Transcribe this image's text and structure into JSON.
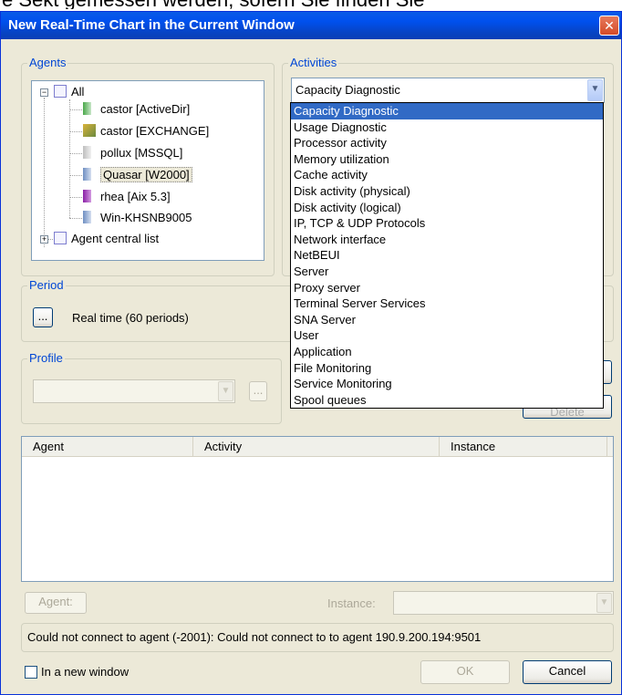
{
  "background_text": "e Sekt gemessen werden, sofern Sie finden Sie",
  "window": {
    "title": "New Real-Time Chart in the Current Window"
  },
  "agents": {
    "label": "Agents",
    "root": "All",
    "items": [
      {
        "label": "castor [ActiveDir]",
        "icon": "server-green-icon"
      },
      {
        "label": "castor [EXCHANGE]",
        "icon": "exchange-server-icon"
      },
      {
        "label": "pollux [MSSQL]",
        "icon": "sql-server-icon"
      },
      {
        "label": "Quasar [W2000]",
        "icon": "windows-server-icon"
      },
      {
        "label": "rhea [Aix 5.3]",
        "icon": "aix-server-icon"
      },
      {
        "label": "Win-KHSNB9005",
        "icon": "windows-server-icon"
      }
    ],
    "central": "Agent central list"
  },
  "activities": {
    "label": "Activities",
    "selected": "Capacity Diagnostic",
    "options": [
      "Capacity Diagnostic",
      "Usage Diagnostic",
      "Processor activity",
      "Memory utilization",
      "Cache activity",
      "Disk activity (physical)",
      "Disk activity (logical)",
      "IP, TCP & UDP Protocols",
      "Network interface",
      "NetBEUI",
      "Server",
      "Proxy server",
      "Terminal Server Services",
      "SNA Server",
      "User",
      "Application",
      "File Monitoring",
      "Service Monitoring",
      "Spool queues"
    ]
  },
  "period": {
    "label": "Period",
    "button": "...",
    "value": "Real time (60 periods)"
  },
  "profile": {
    "label": "Profile",
    "button": "..."
  },
  "hidden_button": "Delete",
  "table": {
    "columns": [
      "Agent",
      "Activity",
      "Instance"
    ]
  },
  "bottom": {
    "agent_button": "Agent:",
    "instance_label": "Instance:",
    "status": "Could not connect to agent (-2001): Could not connect to to agent 190.9.200.194:9501",
    "new_window": "In a new window",
    "ok": "OK",
    "cancel": "Cancel"
  },
  "colors": {
    "title_bar": "#0050EE",
    "selection": "#316AC5",
    "group_label": "#0046D5",
    "dialog_bg": "#ECE9D8"
  }
}
